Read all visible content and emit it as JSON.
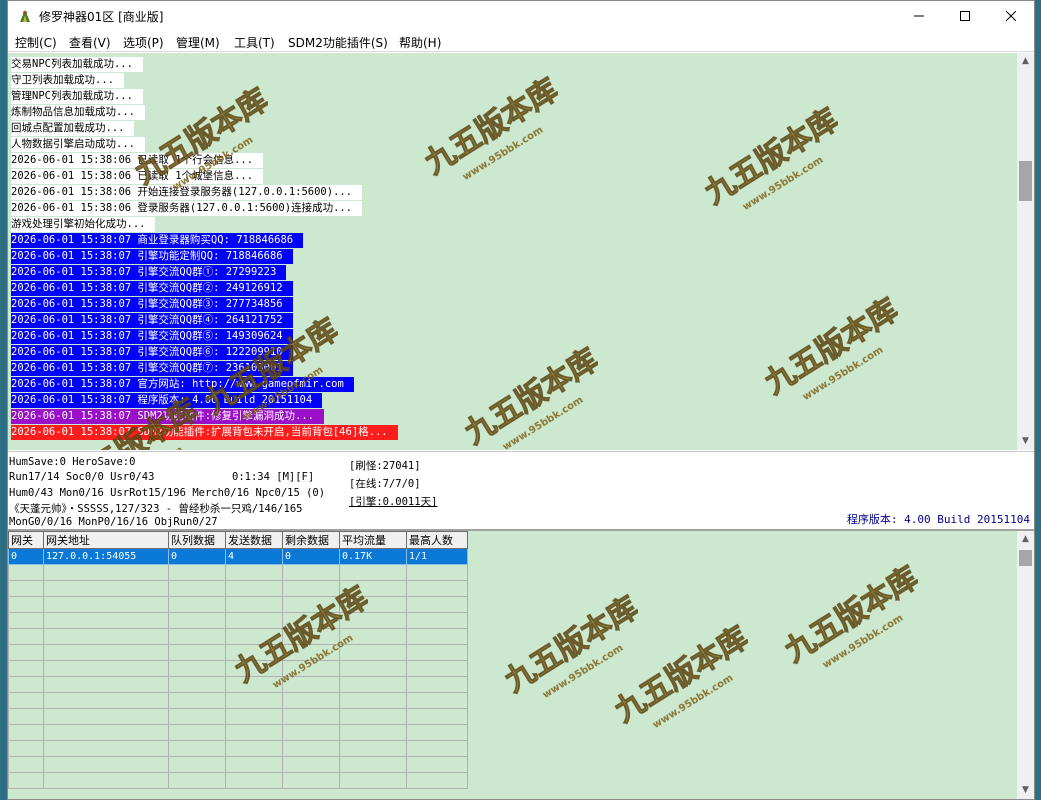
{
  "window": {
    "title": "修罗神器01区 [商业版]"
  },
  "menu": [
    "控制(C)",
    "查看(V)",
    "选项(P)",
    "管理(M)",
    "工具(T)",
    "SDM2功能插件(S)",
    "帮助(H)"
  ],
  "log": {
    "lines": [
      {
        "text": "交易NPC列表加载成功...",
        "bg": "#ffffff",
        "fg": "#000000"
      },
      {
        "text": "守卫列表加载成功...",
        "bg": "#ffffff",
        "fg": "#000000"
      },
      {
        "text": "管理NPC列表加载成功...",
        "bg": "#ffffff",
        "fg": "#000000"
      },
      {
        "text": "炼制物品信息加载成功...",
        "bg": "#ffffff",
        "fg": "#000000"
      },
      {
        "text": "回城点配置加载成功...",
        "bg": "#ffffff",
        "fg": "#000000"
      },
      {
        "text": "人物数据引擎启动成功...",
        "bg": "#ffffff",
        "fg": "#000000"
      },
      {
        "text": "2026-06-01 15:38:06 已读取 1个行会信息...",
        "bg": "#ffffff",
        "fg": "#000000"
      },
      {
        "text": "2026-06-01 15:38:06 已读取 1个城堡信息...",
        "bg": "#ffffff",
        "fg": "#000000"
      },
      {
        "text": "2026-06-01 15:38:06 开始连接登录服务器(127.0.0.1:5600)...",
        "bg": "#ffffff",
        "fg": "#000000"
      },
      {
        "text": "2026-06-01 15:38:06 登录服务器(127.0.0.1:5600)连接成功...",
        "bg": "#ffffff",
        "fg": "#000000"
      },
      {
        "text": "游戏处理引擎初始化成功...",
        "bg": "#ffffff",
        "fg": "#000000"
      },
      {
        "text": "2026-06-01 15:38:07 商业登录器购买QQ: 718846686",
        "bg": "#0000ff",
        "fg": "#ffffff"
      },
      {
        "text": "2026-06-01 15:38:07 引擎功能定制QQ: 718846686",
        "bg": "#0000ff",
        "fg": "#ffffff"
      },
      {
        "text": "2026-06-01 15:38:07 引擎交流QQ群①: 27299223",
        "bg": "#0000ff",
        "fg": "#ffffff"
      },
      {
        "text": "2026-06-01 15:38:07 引擎交流QQ群②: 249126912",
        "bg": "#0000ff",
        "fg": "#ffffff"
      },
      {
        "text": "2026-06-01 15:38:07 引擎交流QQ群③: 277734856",
        "bg": "#0000ff",
        "fg": "#ffffff"
      },
      {
        "text": "2026-06-01 15:38:07 引擎交流QQ群④: 264121752",
        "bg": "#0000ff",
        "fg": "#ffffff"
      },
      {
        "text": "2026-06-01 15:38:07 引擎交流QQ群⑤: 149309624",
        "bg": "#0000ff",
        "fg": "#ffffff"
      },
      {
        "text": "2026-06-01 15:38:07 引擎交流QQ群⑥: 122209910",
        "bg": "#0000ff",
        "fg": "#ffffff"
      },
      {
        "text": "2026-06-01 15:38:07 引擎交流QQ群⑦: 236103001",
        "bg": "#0000ff",
        "fg": "#ffffff"
      },
      {
        "text": "2026-06-01 15:38:07 官方网站: http://www.gameofmir.com",
        "bg": "#0000ff",
        "fg": "#ffffff"
      },
      {
        "text": "2026-06-01 15:38:07 程序版本: 4.00 Build 20151104",
        "bg": "#0000ff",
        "fg": "#ffffff"
      },
      {
        "text": "2026-06-01 15:38:07 SDM2功能插件:修复引擎漏洞成功...",
        "bg": "#9a10c8",
        "fg": "#ffffff"
      },
      {
        "text": "2026-06-01 15:38:07 SDM2功能插件:扩展背包未开启,当前背包[46]格...",
        "bg": "#ff1c1c",
        "fg": "#ffffff"
      }
    ]
  },
  "status": {
    "humsave": "HumSave:0 HeroSave:0",
    "run": "Run17/14 Soc0/0 Usr0/43",
    "time": "0:1:34 [M][F]",
    "hum": "Hum0/43 Mon0/16 UsrRot15/196 Merch0/16 Npc0/15 (0)",
    "player": "《天蓬元帅》・SSSSS,127/323 - 曾经秒杀一只鸡/146/165",
    "mongen": "MonG0/0/16 MonP0/16/16 ObjRun0/27",
    "refresh": "[刷怪:27041]",
    "online": "[在线:7/7/0]",
    "engine": "[引擎:0.0011天]",
    "version": "程序版本: 4.00 Build 20151104"
  },
  "gateway_table": {
    "headers": [
      "网关",
      "网关地址",
      "队列数据",
      "发送数据",
      "剩余数据",
      "平均流量",
      "最高人数"
    ],
    "rows": [
      [
        "0",
        "127.0.0.1:54055",
        "0",
        "4",
        "0",
        "0.17K",
        "1/1"
      ]
    ]
  },
  "watermark": {
    "text": "九五版本库",
    "url": "www.95bbk.com",
    "color": "#c9a227"
  }
}
